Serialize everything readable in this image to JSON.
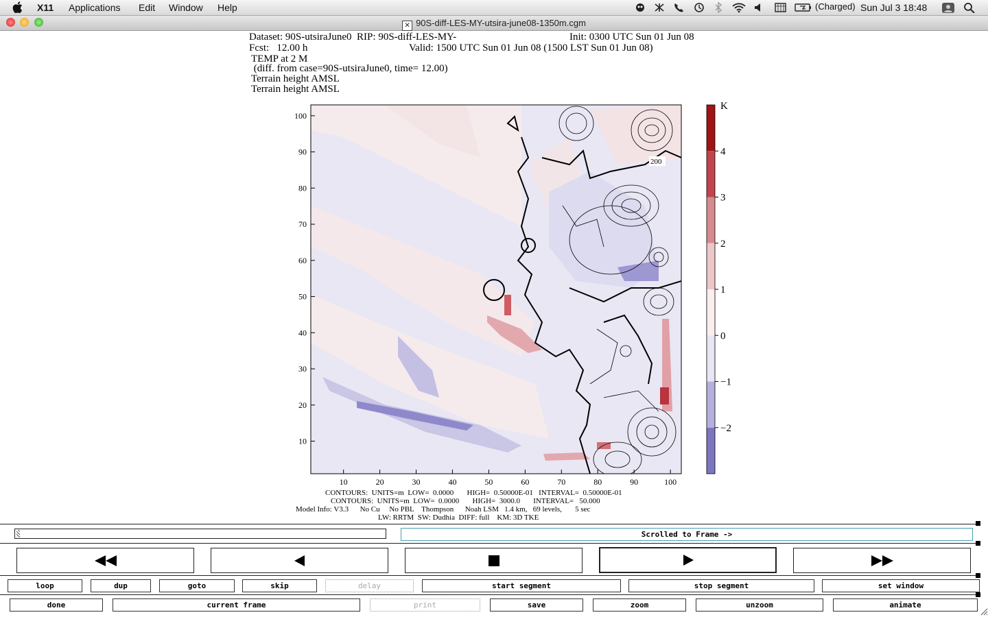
{
  "menubar": {
    "items": [
      "X11",
      "Applications",
      "Edit",
      "Window",
      "Help"
    ],
    "battery": "(Charged)",
    "datetime": "Sun Jul 3  18:48"
  },
  "window": {
    "title": "90S-diff-LES-MY-utsira-june08-1350m.cgm"
  },
  "plot": {
    "dataset_line": "Dataset: 90S-utsiraJune0  RIP: 90S-diff-LES-MY-",
    "init": "Init: 0300 UTC Sun 01 Jun 08",
    "fcst": "Fcst:   12.00 h",
    "valid": "Valid: 1500 UTC Sun 01 Jun 08 (1500 LST Sun 01 Jun 08)",
    "field": "TEMP at 2 M",
    "diff": " (diff. from case=90S-utsiraJune0, time= 12.00)",
    "terrain1": "Terrain height AMSL",
    "terrain2": "Terrain height AMSL",
    "contour_label": "200",
    "footer1": "CONTOURS:  UNITS=m  LOW=  0.0000       HIGH=  0.50000E-01   INTERVAL=  0.50000E-01",
    "footer2": "CONTOURS:  UNITS=m  LOW=  0.0000       HIGH=  3000.0       INTERVAL=   50.000",
    "footer3": "Model Info: V3.3      No Cu     No PBL    Thompson      Noah LSM   1.4 km,   69 levels,       5 sec",
    "footer4": "LW: RRTM  SW: Dudhia  DIFF: full    KM: 3D TKE"
  },
  "chart_data": {
    "type": "heatmap",
    "title": "TEMP at 2 M",
    "x_ticks": [
      10,
      20,
      30,
      40,
      50,
      60,
      70,
      80,
      90,
      100
    ],
    "y_ticks": [
      10,
      20,
      30,
      40,
      50,
      60,
      70,
      80,
      90,
      100
    ],
    "xlim": [
      1,
      103
    ],
    "ylim": [
      1,
      103
    ],
    "colorbar": {
      "unit": "K",
      "ticks": [
        4,
        3,
        2,
        1,
        0,
        -1,
        -2
      ],
      "tick_labels": [
        "4",
        "3",
        "2",
        "1",
        "0",
        "−1",
        "−2"
      ],
      "colors": [
        "#a01414",
        "#c2444c",
        "#d68a90",
        "#ecc6c8",
        "#fbeeee",
        "#e8e6f4",
        "#b5b1dc",
        "#7c76c0"
      ]
    }
  },
  "controls": {
    "status": "Scrolled to Frame ->",
    "row1": [
      "loop",
      "dup",
      "goto",
      "skip",
      "delay",
      "start segment",
      "stop segment",
      "set window"
    ],
    "row2": [
      "done",
      "current frame",
      "print",
      "save",
      "zoom",
      "unzoom",
      "animate"
    ]
  }
}
